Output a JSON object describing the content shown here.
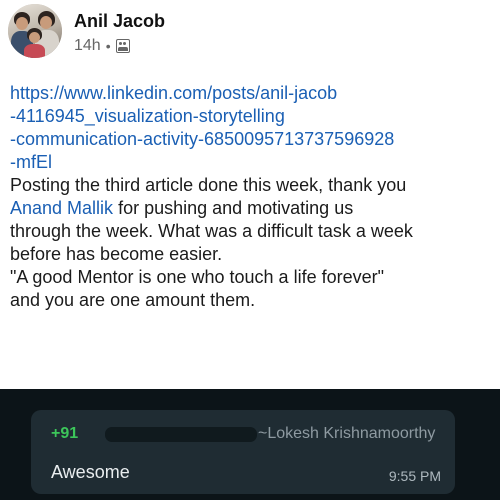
{
  "post": {
    "author": "Anil Jacob",
    "time": "14h",
    "separator": "•",
    "audience_icon": "connections-icon",
    "link_lines": [
      "https://www.linkedin.com/posts/anil-jacob",
      "-4116945_visualization-storytelling",
      "-communication-activity-6850095713737596928",
      "-mfEl"
    ],
    "body": {
      "line1": "Posting the third article done this week, thank you",
      "mention": "Anand Mallik",
      "line2_rest": " for pushing and motivating us",
      "line3": "through the week. What was a difficult task a week",
      "line4": "before has become easier.",
      "line5": "\"A good Mentor is one who touch a life forever\"",
      "line6": "and you are one amount them."
    }
  },
  "chat": {
    "sender_phone": "+91",
    "sender_name": "~Lokesh Krishnamoorthy",
    "message": "Awesome",
    "time": "9:55 PM"
  },
  "colors": {
    "link": "#1a5fb4",
    "chat_background": "#0c1418",
    "bubble": "#1f2c33",
    "sender_phone": "#3cc65a"
  }
}
